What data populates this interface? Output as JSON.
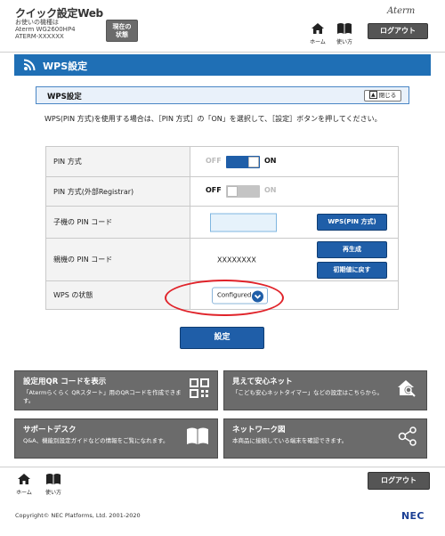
{
  "header": {
    "title": "クイック設定Web",
    "sub_line1": "お使いの機種は",
    "sub_line2": "Aterm WG2600HP4",
    "sub_line3": "ATERM-XXXXXX",
    "status_button_line1": "現在の",
    "status_button_line2": "状態",
    "logo_text": "Aterm",
    "home_label": "ホーム",
    "help_label": "使い方",
    "logout_label": "ログアウト"
  },
  "banner": {
    "title": "WPS設定"
  },
  "section": {
    "title": "WPS設定",
    "close_label": "閉じる"
  },
  "description": "WPS(PIN 方式)を使用する場合は、［PIN 方式］の「ON」を選択して、［設定］ボタンを押してください。",
  "rows": {
    "pin_method": {
      "label": "PIN 方式",
      "off": "OFF",
      "on": "ON",
      "state": "on"
    },
    "pin_external": {
      "label": "PIN 方式(外部Registrar)",
      "off": "OFF",
      "on": "ON",
      "state": "off"
    },
    "child_pin": {
      "label": "子機の PIN コード",
      "value": "",
      "button": "WPS(PIN 方式)"
    },
    "parent_pin": {
      "label": "親機の PIN コード",
      "value": "XXXXXXXX",
      "regenerate": "再生成",
      "reset": "初期値に戻す"
    },
    "wps_status": {
      "label": "WPS の状態",
      "value": "Configured"
    }
  },
  "submit_label": "設定",
  "tiles": [
    {
      "title": "設定用QR コードを表示",
      "desc": "「Atermらくらく QRスタート」用のQRコードを作成できます。",
      "icon": "qr-code-icon"
    },
    {
      "title": "見えて安心ネット",
      "desc": "「こども安心ネットタイマー」などの設定はこちらから。",
      "icon": "home-search-icon"
    },
    {
      "title": "サポートデスク",
      "desc": "Q&A、機能別設定ガイドなどの情報をご覧になれます。",
      "icon": "book-icon"
    },
    {
      "title": "ネットワーク図",
      "desc": "本商品に接続している端末を確認できます。",
      "icon": "network-icon"
    }
  ],
  "footer": {
    "home_label": "ホーム",
    "help_label": "使い方",
    "logout_label": "ログアウト",
    "copyright": "Copyright© NEC Platforms, Ltd. 2001-2020",
    "brand": "NEC"
  },
  "colors": {
    "accent_blue": "#1f6fb5",
    "button_blue": "#1f5ea8",
    "tile_gray": "#6b6b6b",
    "highlight_red": "#e0232a"
  }
}
